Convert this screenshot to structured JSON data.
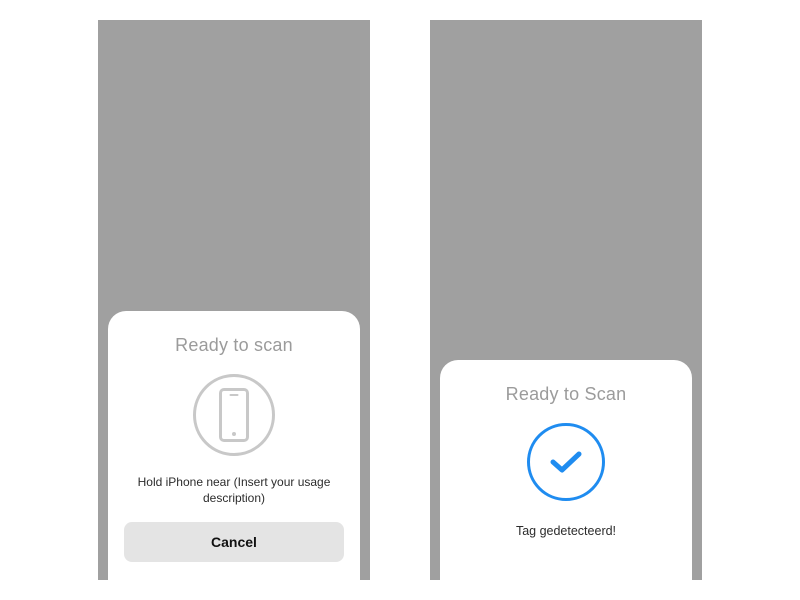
{
  "left": {
    "title": "Ready to scan",
    "subtitle": "Hold iPhone near (Insert your usage description)",
    "cancel_label": "Cancel",
    "icon": "phone-outline-icon"
  },
  "right": {
    "title": "Ready to Scan",
    "subtitle": "Tag gedetecteerd!",
    "icon": "checkmark-icon",
    "accent_color": "#1f8cf0"
  }
}
